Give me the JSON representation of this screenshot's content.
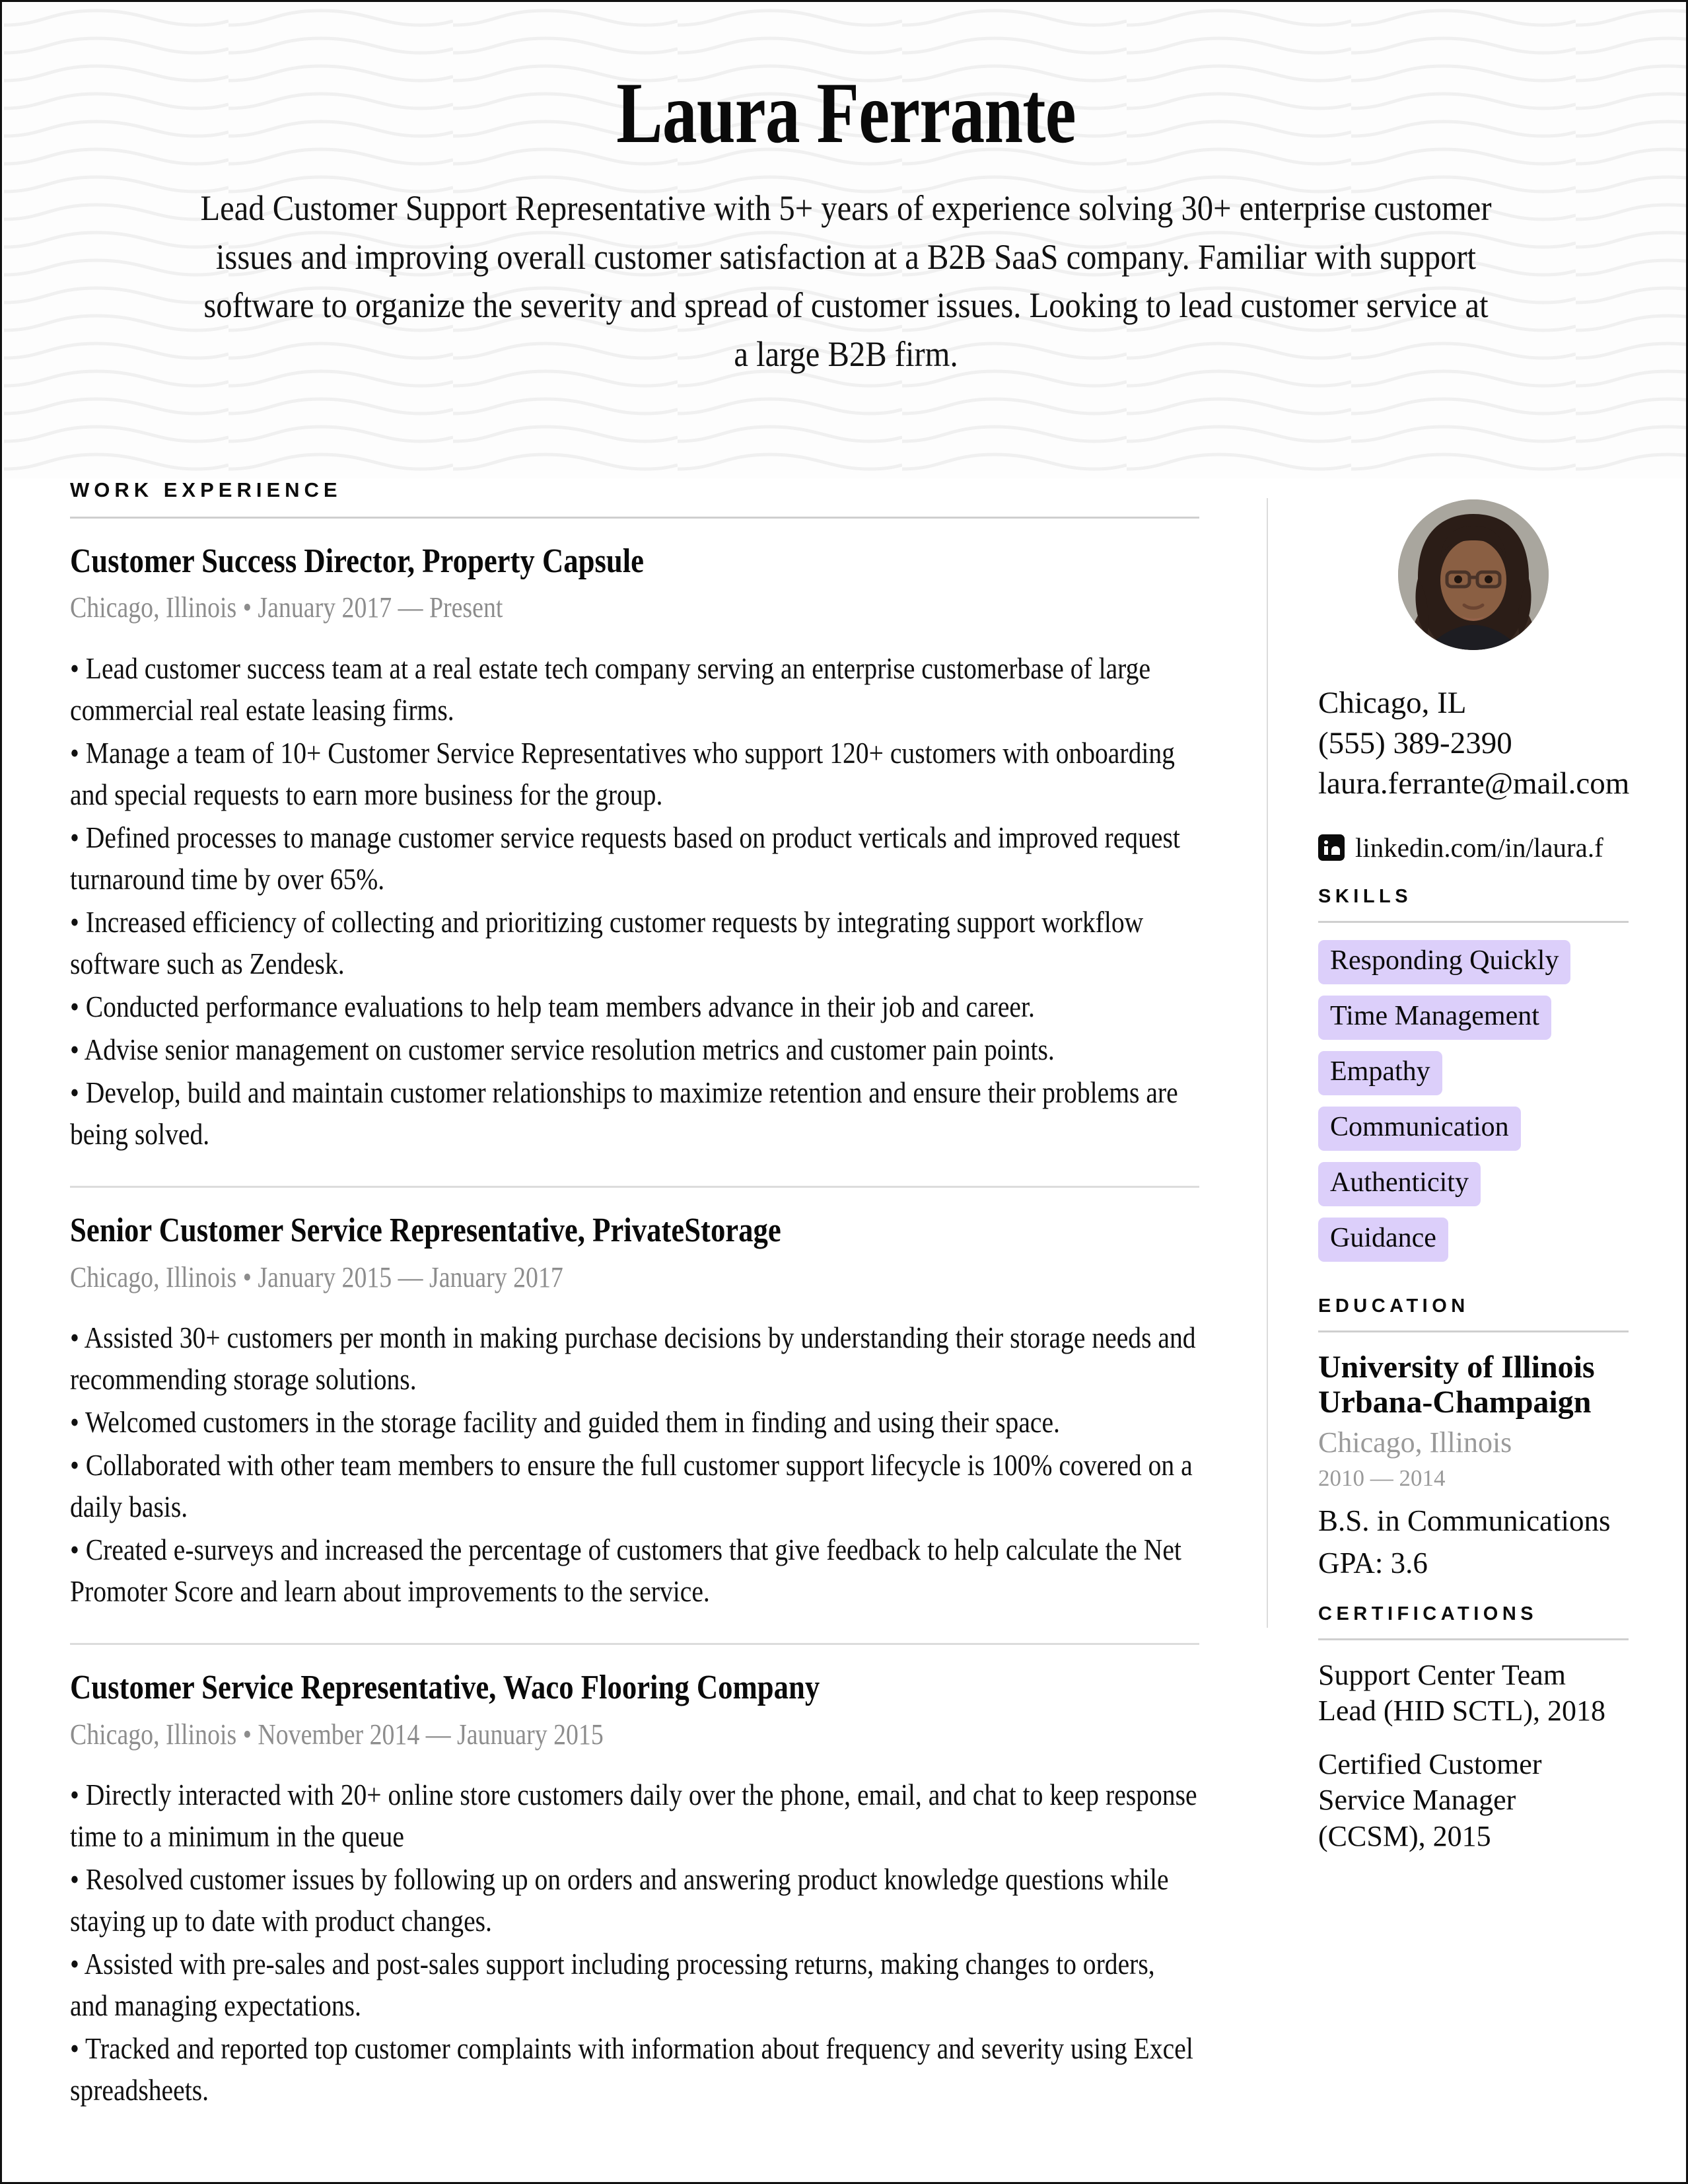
{
  "header": {
    "name": "Laura Ferrante",
    "summary": "Lead Customer Support Representative with 5+ years of experience solving 30+ enterprise customer issues and improving overall customer satisfaction at a B2B SaaS company. Familiar with support software to organize the severity and spread of customer issues. Looking to lead customer service at a large B2B firm."
  },
  "work": {
    "label": "WORK EXPERIENCE",
    "jobs": [
      {
        "title": "Customer Success Director, Property Capsule",
        "meta": "Chicago, Illinois • January 2017 — Present",
        "bullets": [
          "• Lead customer success team at a real estate tech company serving an enterprise customerbase of large commercial real estate leasing firms.",
          "• Manage a team of 10+ Customer Service Representatives who support 120+ customers with onboarding and special requests to earn more business for the group.",
          "• Defined processes to manage customer service requests based on product verticals and improved request turnaround time by over 65%.",
          "• Increased efficiency of collecting and prioritizing customer requests by integrating support workflow software such as Zendesk.",
          "• Conducted performance evaluations to help team members advance in their job and career.",
          "• Advise senior management on customer service resolution metrics and customer pain points.",
          "• Develop, build and maintain customer relationships to maximize retention and ensure their problems are being solved."
        ]
      },
      {
        "title": "Senior Customer Service Representative, PrivateStorage",
        "meta": "Chicago, Illinois • January 2015 — January 2017",
        "bullets": [
          "• Assisted 30+ customers per month in making purchase decisions by understanding their storage needs and recommending storage solutions.",
          "• Welcomed customers in the storage facility and guided them in finding and using their space.",
          "• Collaborated with other team members to ensure the full customer support lifecycle is 100% covered on a daily basis.",
          "• Created e-surveys and increased the percentage of customers that give feedback to help calculate the Net Promoter Score and learn about improvements to the service."
        ]
      },
      {
        "title": "Customer Service Representative, Waco Flooring Company",
        "meta": "Chicago, Illinois • November 2014 — Jaunuary 2015",
        "bullets": [
          "• Directly interacted with 20+ online store customers daily over the phone, email, and chat to keep response time to a minimum in the queue",
          "• Resolved customer issues by following up on orders and answering product knowledge questions while staying up to date with product changes.",
          "• Assisted with pre-sales and post-sales support including processing returns, making changes to orders, and managing expectations.",
          "• Tracked and reported top customer complaints with information about frequency and severity using Excel spreadsheets."
        ]
      }
    ]
  },
  "contact": {
    "location": "Chicago, IL",
    "phone": "(555) 389-2390",
    "email": "laura.ferrante@mail.com",
    "linkedin": "linkedin.com/in/laura.f"
  },
  "skills": {
    "label": "SKILLS",
    "pill_color": "#DCCFFA",
    "items": [
      "Responding Quickly",
      "Time Management",
      "Empathy",
      "Communication",
      "Authenticity",
      "Guidance"
    ]
  },
  "education": {
    "label": "EDUCATION",
    "school": "University of Illinois Urbana-Champaign",
    "location": "Chicago, Illinois",
    "years": "2010 — 2014",
    "degree": "B.S. in Communications",
    "gpa": "GPA: 3.6"
  },
  "certifications": {
    "label": "CERTIFICATIONS",
    "items": [
      "Support Center Team Lead (HID SCTL), 2018",
      "Certified Customer Service Manager (CCSM), 2015"
    ]
  }
}
